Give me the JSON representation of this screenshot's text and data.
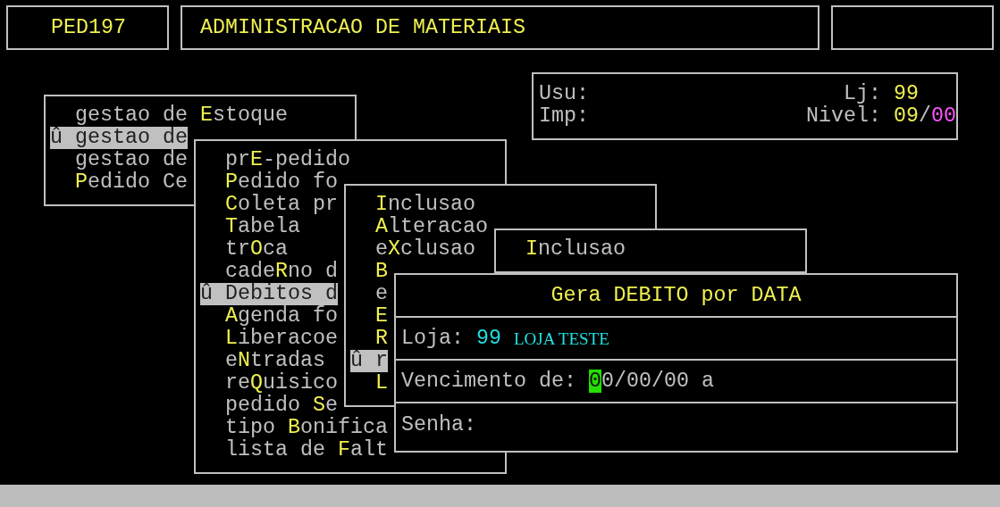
{
  "header": {
    "code": "PED197",
    "title": "ADMINISTRACAO DE MATERIAIS"
  },
  "status": {
    "rows": [
      {
        "label": "Usu:",
        "right_label": "Lj:",
        "values": [
          {
            "text": "99",
            "color": "#f0f050"
          }
        ]
      },
      {
        "label": "Imp:",
        "right_label": "Nivel:",
        "values": [
          {
            "text": "09",
            "color": "#f0f050"
          },
          {
            "text": "/",
            "color": "#c0c0c0"
          },
          {
            "text": "00",
            "color": "#ff55ff"
          }
        ]
      }
    ]
  },
  "menus": [
    {
      "items": [
        {
          "pre": "gestao de ",
          "key": "E",
          "post": "stoque",
          "selected": false
        },
        {
          "marker": "û",
          "pre": "gestao de",
          "selected": true
        },
        {
          "pre": "gestao de",
          "selected": false
        },
        {
          "key": "P",
          "post": "edido Ce",
          "selected": false
        }
      ]
    },
    {
      "items": [
        {
          "pre": "pr",
          "key": "E",
          "post": "-pedido",
          "selected": false
        },
        {
          "key": "P",
          "post": "edido fo",
          "selected": false
        },
        {
          "key": "C",
          "post": "oleta pr",
          "selected": false
        },
        {
          "key": "T",
          "post": "abela",
          "selected": false
        },
        {
          "pre": "tr",
          "key": "O",
          "post": "ca",
          "selected": false
        },
        {
          "pre": "cade",
          "key": "R",
          "post": "no d",
          "selected": false
        },
        {
          "marker": "û",
          "pre": "Debitos d",
          "selected": true
        },
        {
          "key": "A",
          "post": "genda fo",
          "selected": false
        },
        {
          "key": "L",
          "post": "iberacoe",
          "selected": false
        },
        {
          "pre": "e",
          "key": "N",
          "post": "tradas",
          "selected": false
        },
        {
          "pre": "re",
          "key": "Q",
          "post": "uisico",
          "selected": false
        },
        {
          "pre": "pedido ",
          "key": "S",
          "post": "e",
          "selected": false
        },
        {
          "pre": "tipo ",
          "key": "B",
          "post": "onifica",
          "selected": false
        },
        {
          "pre": "lista de ",
          "key": "F",
          "post": "alt",
          "selected": false
        }
      ]
    },
    {
      "items": [
        {
          "key": "I",
          "post": "nclusao",
          "selected": false
        },
        {
          "key": "A",
          "post": "lteracao",
          "selected": false
        },
        {
          "pre": "e",
          "key": "X",
          "post": "clusao",
          "selected": false
        },
        {
          "key": "B",
          "selected": false
        },
        {
          "pre": "e",
          "selected": false
        },
        {
          "key": "E",
          "selected": false
        },
        {
          "key": "R",
          "selected": false
        },
        {
          "marker": "û",
          "pre": "r",
          "selected": true
        },
        {
          "key": "L",
          "selected": false
        }
      ]
    },
    {
      "items": [
        {
          "key": "I",
          "post": "nclusao",
          "selected": false
        }
      ]
    }
  ],
  "dialog": {
    "title": "Gera DEBITO por DATA",
    "rows": [
      {
        "kind": "store",
        "label": "Loja:",
        "code": "99",
        "name": "LOJA TESTE"
      },
      {
        "kind": "date",
        "label": "Vencimento de:",
        "value": "00/00/00",
        "cursor": true,
        "suffix": "a"
      },
      {
        "kind": "password",
        "label": "Senha:"
      }
    ]
  }
}
